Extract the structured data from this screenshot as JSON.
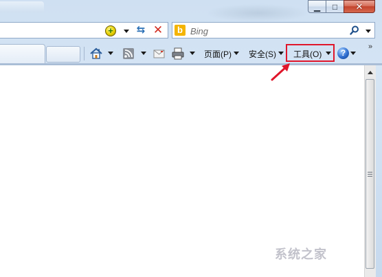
{
  "window": {
    "minimize_glyph": "▁",
    "maximize_glyph": "□",
    "close_glyph": "✕"
  },
  "search": {
    "placeholder": "Bing",
    "engine_logo": "b"
  },
  "toolbar": {
    "page_label": "页面(P)",
    "safety_label": "安全(S)",
    "tools_label": "工具(O)",
    "help_glyph": "?",
    "overflow_glyph": "»"
  },
  "icons": {
    "compat": "compatibility-view-icon",
    "refresh": "refresh-icon",
    "stop": "stop-icon",
    "home": "home-icon",
    "feeds": "rss-feed-icon",
    "mail": "read-mail-icon",
    "print": "print-icon",
    "help": "help-icon",
    "search": "search-icon"
  },
  "annotation": {
    "highlight_color": "#e0152a",
    "arrow_color": "#e0152a",
    "highlighted_item": "tools_label"
  },
  "watermark": {
    "text": "系统之家"
  }
}
